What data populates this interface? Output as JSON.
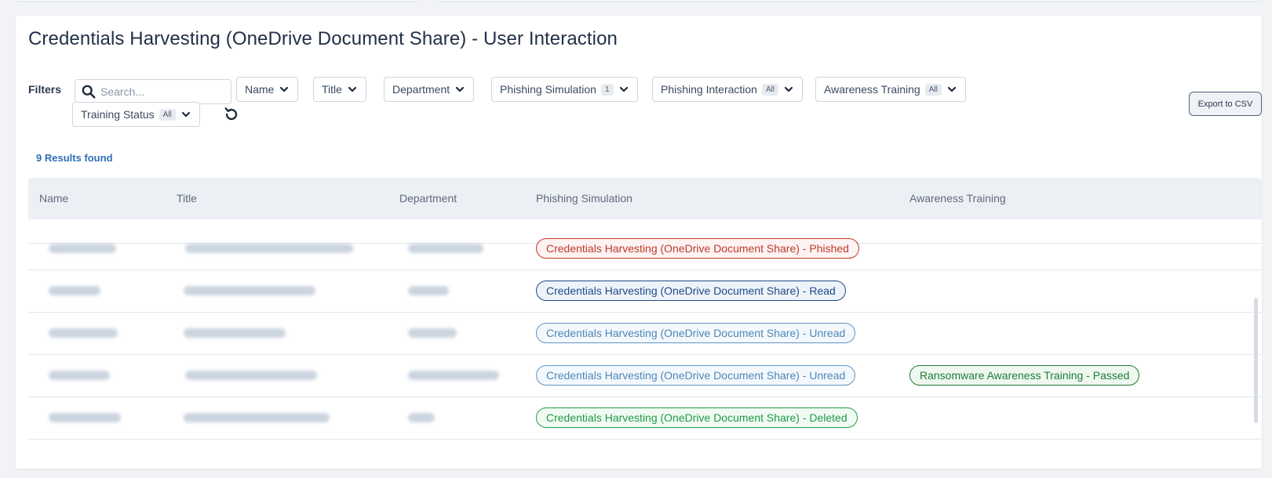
{
  "page": {
    "title": "Credentials Harvesting (OneDrive Document Share) - User Interaction"
  },
  "filters": {
    "label": "Filters",
    "search_placeholder": "Search...",
    "dropdowns": [
      {
        "label": "Name",
        "badge": ""
      },
      {
        "label": "Title",
        "badge": ""
      },
      {
        "label": "Department",
        "badge": ""
      },
      {
        "label": "Phishing Simulation",
        "badge": "1"
      },
      {
        "label": "Phishing Interaction",
        "badge": "All"
      },
      {
        "label": "Awareness Training",
        "badge": "All"
      },
      {
        "label": "Training Status",
        "badge": "All"
      }
    ],
    "export_label": "Export to CSV"
  },
  "results": {
    "text": "9 Results found"
  },
  "table": {
    "columns": [
      "Name",
      "Title",
      "Department",
      "Phishing Simulation",
      "Awareness Training"
    ],
    "rows": [
      {
        "simulation": "Credentials Harvesting (OneDrive Document Share) - Phished",
        "status": "phished",
        "training": ""
      },
      {
        "simulation": "Credentials Harvesting (OneDrive Document Share) - Read",
        "status": "read",
        "training": ""
      },
      {
        "simulation": "Credentials Harvesting (OneDrive Document Share) - Unread",
        "status": "unread",
        "training": ""
      },
      {
        "simulation": "Credentials Harvesting (OneDrive Document Share) - Unread",
        "status": "unread",
        "training": "Ransomware Awareness Training - Passed"
      },
      {
        "simulation": "Credentials Harvesting (OneDrive Document Share) - Deleted",
        "status": "deleted",
        "training": ""
      }
    ]
  },
  "colors": {
    "phished": "#c0392b",
    "read": "#1f4a87",
    "unread": "#4d87b8",
    "deleted": "#1f9944",
    "passed": "#1f7d37",
    "accent": "#2e6fb7"
  },
  "icons": {
    "search": "search-icon",
    "chevron": "chevron-down-icon",
    "reset": "reset-icon"
  }
}
